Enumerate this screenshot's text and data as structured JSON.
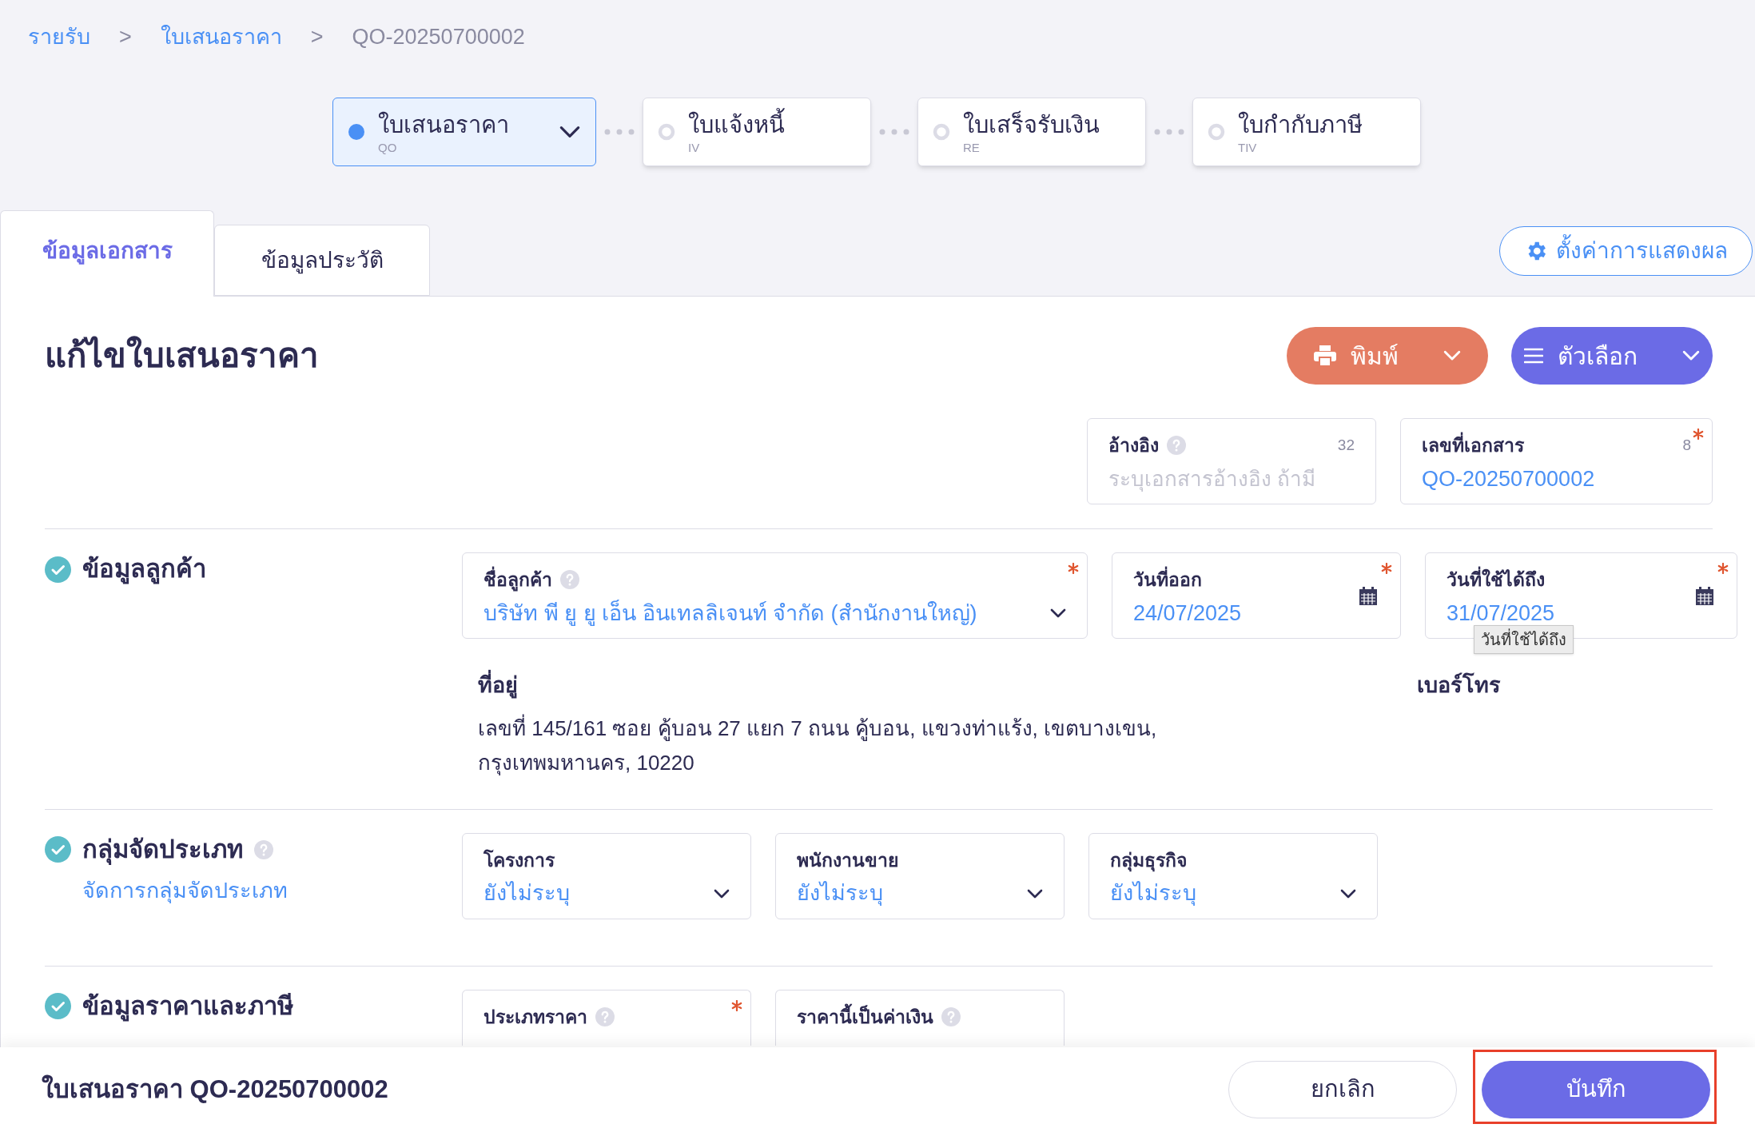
{
  "breadcrumb": [
    {
      "kind": "link",
      "label": "รายรับ"
    },
    {
      "kind": "separator",
      "label": ">"
    },
    {
      "kind": "link",
      "label": "ใบเสนอราคา"
    },
    {
      "kind": "separator",
      "label": ">"
    },
    {
      "kind": "current",
      "label": "QO-20250700002"
    }
  ],
  "steps": [
    {
      "label": "ใบเสนอราคา",
      "code": "QO",
      "selected": true
    },
    {
      "label": "ใบแจ้งหนี้",
      "code": "IV",
      "selected": false
    },
    {
      "label": "ใบเสร็จรับเงิน",
      "code": "RE",
      "selected": false
    },
    {
      "label": "ใบกำกับภาษี",
      "code": "TIV",
      "selected": false
    }
  ],
  "tabs": [
    {
      "label": "ข้อมูลเอกสาร",
      "selected": true
    },
    {
      "label": "ข้อมูลประวัติ",
      "selected": false
    }
  ],
  "display_settings_button": "ตั้งค่าการแสดงผล",
  "page_title": "แก้ไขใบเสนอราคา",
  "actions": [
    {
      "kind": "print",
      "label": "พิมพ์"
    },
    {
      "kind": "options",
      "label": "ตัวเลือก"
    }
  ],
  "header_fields": [
    {
      "label": "อ้างอิง",
      "help": true,
      "counter": "32",
      "placeholder": "ระบุเอกสารอ้างอิง ถ้ามี",
      "required": false
    },
    {
      "label": "เลขที่เอกสาร",
      "help": false,
      "counter": "8",
      "value": "QO-20250700002",
      "required": true
    }
  ],
  "sections": [
    {
      "title": "ข้อมูลลูกค้า",
      "help": false,
      "fields": [
        {
          "kind": "select",
          "wide": true,
          "label": "ชื่อลูกค้า",
          "help": true,
          "value": "บริษัท พี ยู ยู เอ็น อินเทลลิเจนท์ จำกัด (สำนักงานใหญ่)",
          "required": true
        },
        {
          "kind": "date",
          "label": "วันที่ออก",
          "help": false,
          "value": "24/07/2025",
          "required": true
        },
        {
          "kind": "date",
          "label": "วันที่ใช้ได้ถึง",
          "help": false,
          "value": "31/07/2025",
          "required": true,
          "tooltip": "วันที่ใช้ได้ถึง"
        }
      ],
      "address_label": "ที่อยู่",
      "address": "เลขที่ 145/161 ซอย คู้บอน 27 แยก 7 ถนน คู้บอน, แขวงท่าแร้ง, เขตบางเขน, กรุงเทพมหานคร, 10220",
      "phone_label": "เบอร์โทร"
    },
    {
      "title": "กลุ่มจัดประเภท",
      "help": true,
      "link": "จัดการกลุ่มจัดประเภท",
      "fields": [
        {
          "kind": "select",
          "label": "โครงการ",
          "help": false,
          "value": "ยังไม่ระบุ",
          "required": false
        },
        {
          "kind": "select",
          "label": "พนักงานขาย",
          "help": false,
          "value": "ยังไม่ระบุ",
          "required": false
        },
        {
          "kind": "select",
          "label": "กลุ่มธุรกิจ",
          "help": false,
          "value": "ยังไม่ระบุ",
          "required": false
        }
      ]
    },
    {
      "title": "ข้อมูลราคาและภาษี",
      "help": false,
      "fields": [
        {
          "kind": "select",
          "label": "ประเภทราคา",
          "help": true,
          "required": true
        },
        {
          "kind": "select",
          "label": "ราคานี้เป็นค่าเงิน",
          "help": true,
          "required": false
        }
      ]
    }
  ],
  "footer": {
    "title": "ใบเสนอราคา QO-20250700002",
    "buttons": [
      {
        "kind": "cancel",
        "label": "ยกเลิก",
        "highlighted": false
      },
      {
        "kind": "save",
        "label": "บันทึก",
        "highlighted": true
      }
    ]
  }
}
